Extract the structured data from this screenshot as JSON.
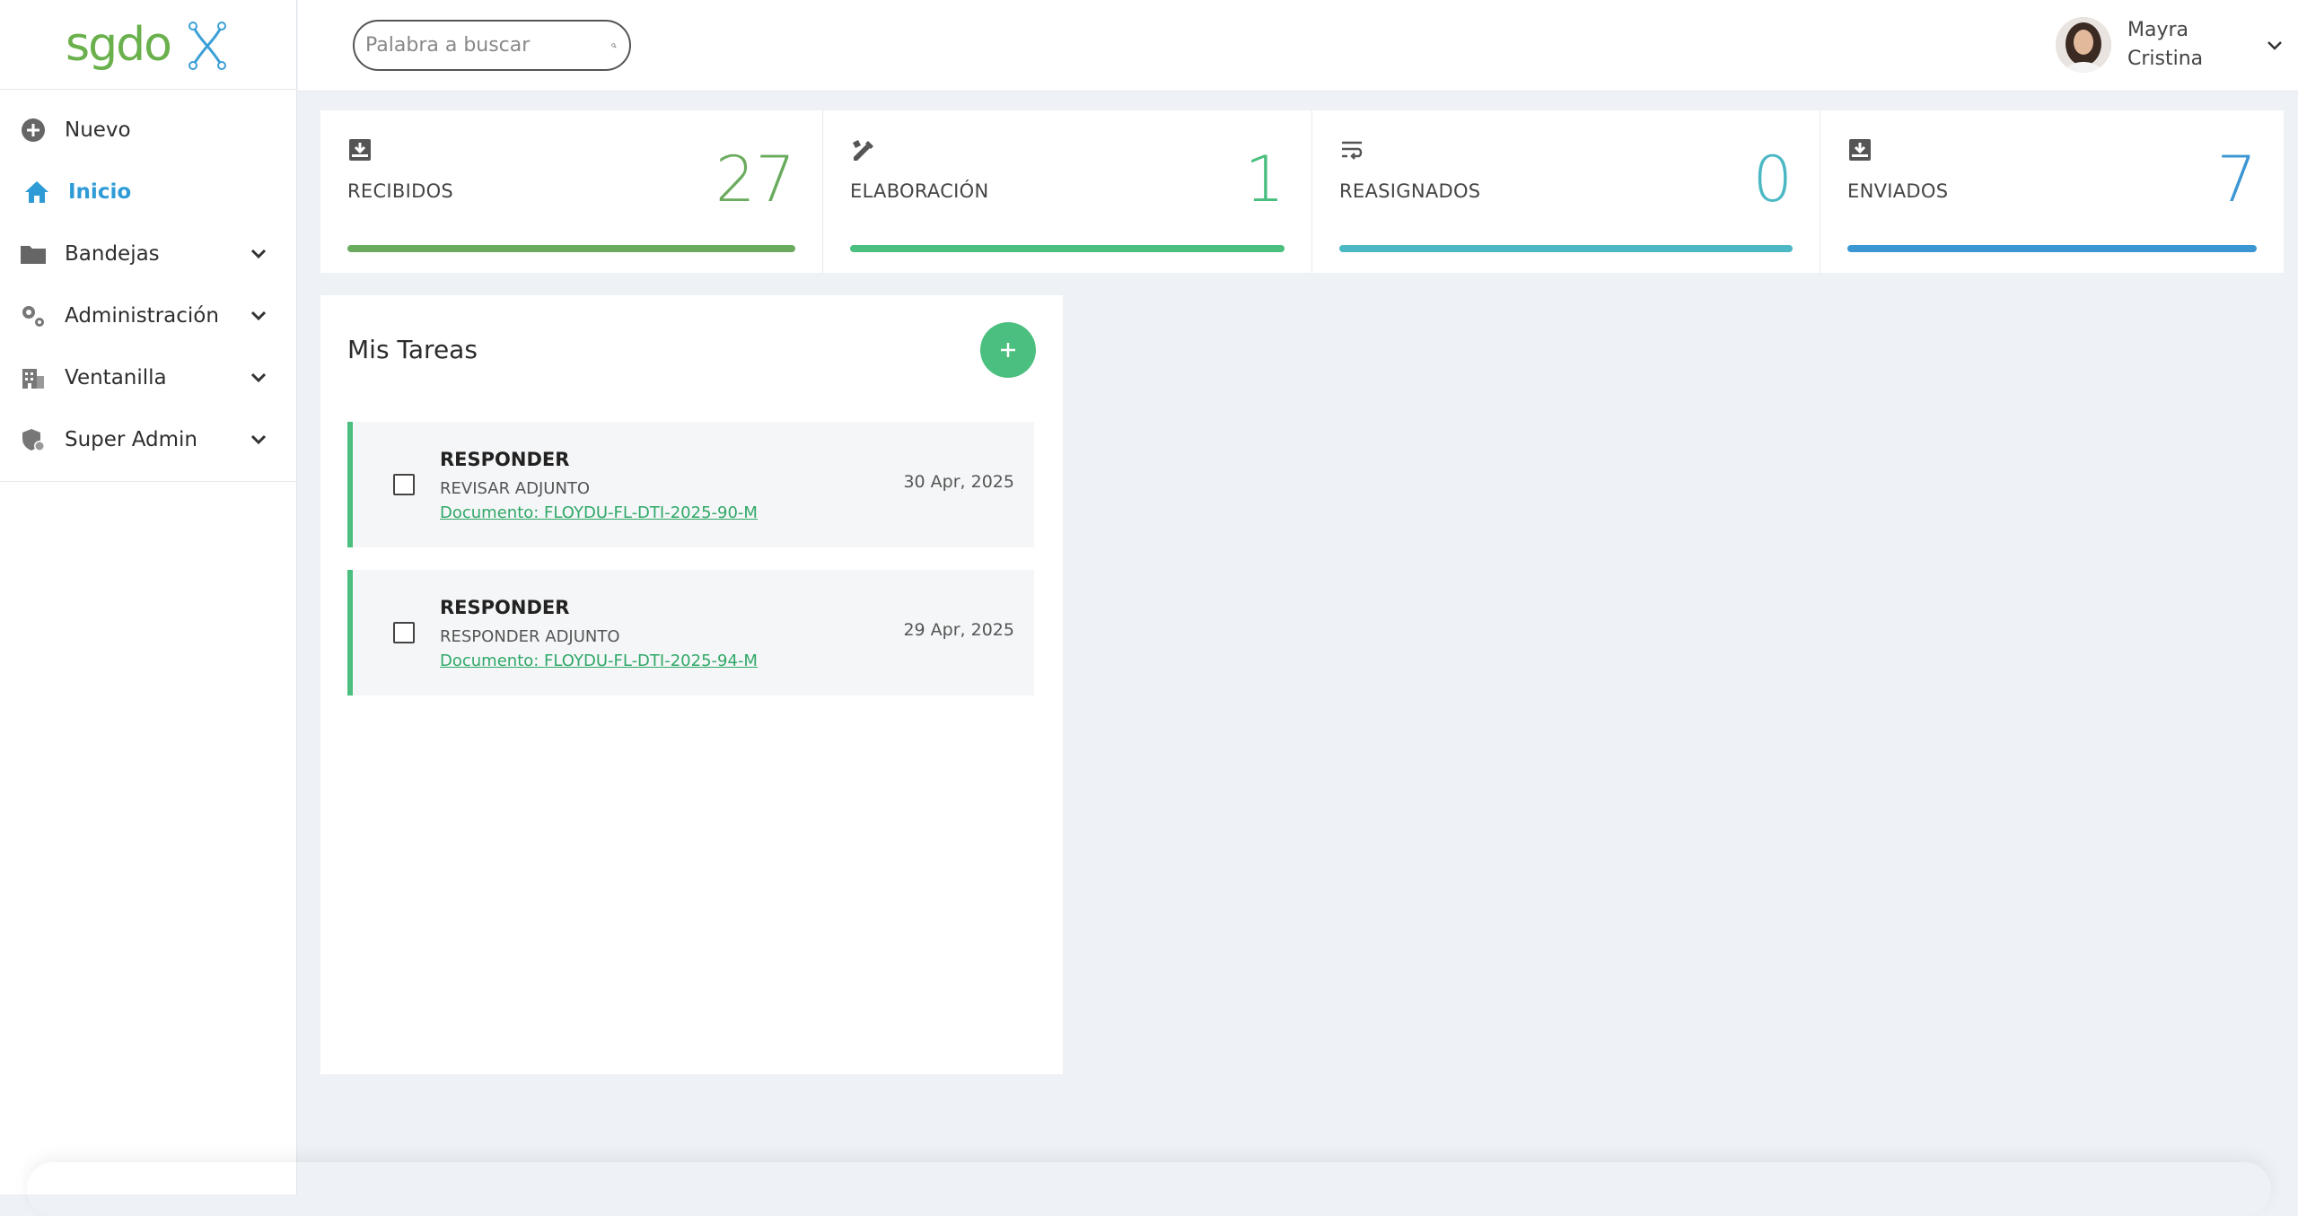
{
  "app": {
    "logo_text": "sgdox"
  },
  "sidebar": {
    "items": [
      {
        "label": "Nuevo",
        "icon": "plus-circle-icon",
        "expandable": false
      },
      {
        "label": "Inicio",
        "icon": "home-icon",
        "expandable": false,
        "active": true
      },
      {
        "label": "Bandejas",
        "icon": "folder-icon",
        "expandable": true
      },
      {
        "label": "Administración",
        "icon": "gears-icon",
        "expandable": true
      },
      {
        "label": "Ventanilla",
        "icon": "building-icon",
        "expandable": true
      },
      {
        "label": "Super Admin",
        "icon": "shield-user-icon",
        "expandable": true
      }
    ]
  },
  "header": {
    "search": {
      "placeholder": "Palabra a buscar",
      "value": ""
    },
    "user": {
      "first": "Mayra",
      "last": "Cristina"
    }
  },
  "stats": [
    {
      "label": "RECIBIDOS",
      "count": "27",
      "color": "#6aab5e",
      "icon": "inbox-download-icon"
    },
    {
      "label": "ELABORACIÓN",
      "count": "1",
      "color": "#4bbf7f",
      "icon": "pencil-ruler-icon"
    },
    {
      "label": "REASIGNADOS",
      "count": "0",
      "color": "#4bb8c4",
      "icon": "wrap-text-icon"
    },
    {
      "label": "ENVIADOS",
      "count": "7",
      "color": "#3b97d3",
      "icon": "inbox-download-icon"
    }
  ],
  "tasks": {
    "title": "Mis Tareas",
    "items": [
      {
        "title": "RESPONDER",
        "description": "REVISAR ADJUNTO",
        "link": "Documento: FLOYDU-FL-DTI-2025-90-M",
        "date": "30 Apr, 2025"
      },
      {
        "title": "RESPONDER",
        "description": "RESPONDER ADJUNTO",
        "link": "Documento: FLOYDU-FL-DTI-2025-94-M",
        "date": "29 Apr, 2025"
      }
    ]
  },
  "colors": {
    "accent_green": "#4bbf7f",
    "active_blue": "#2e9bd6"
  }
}
